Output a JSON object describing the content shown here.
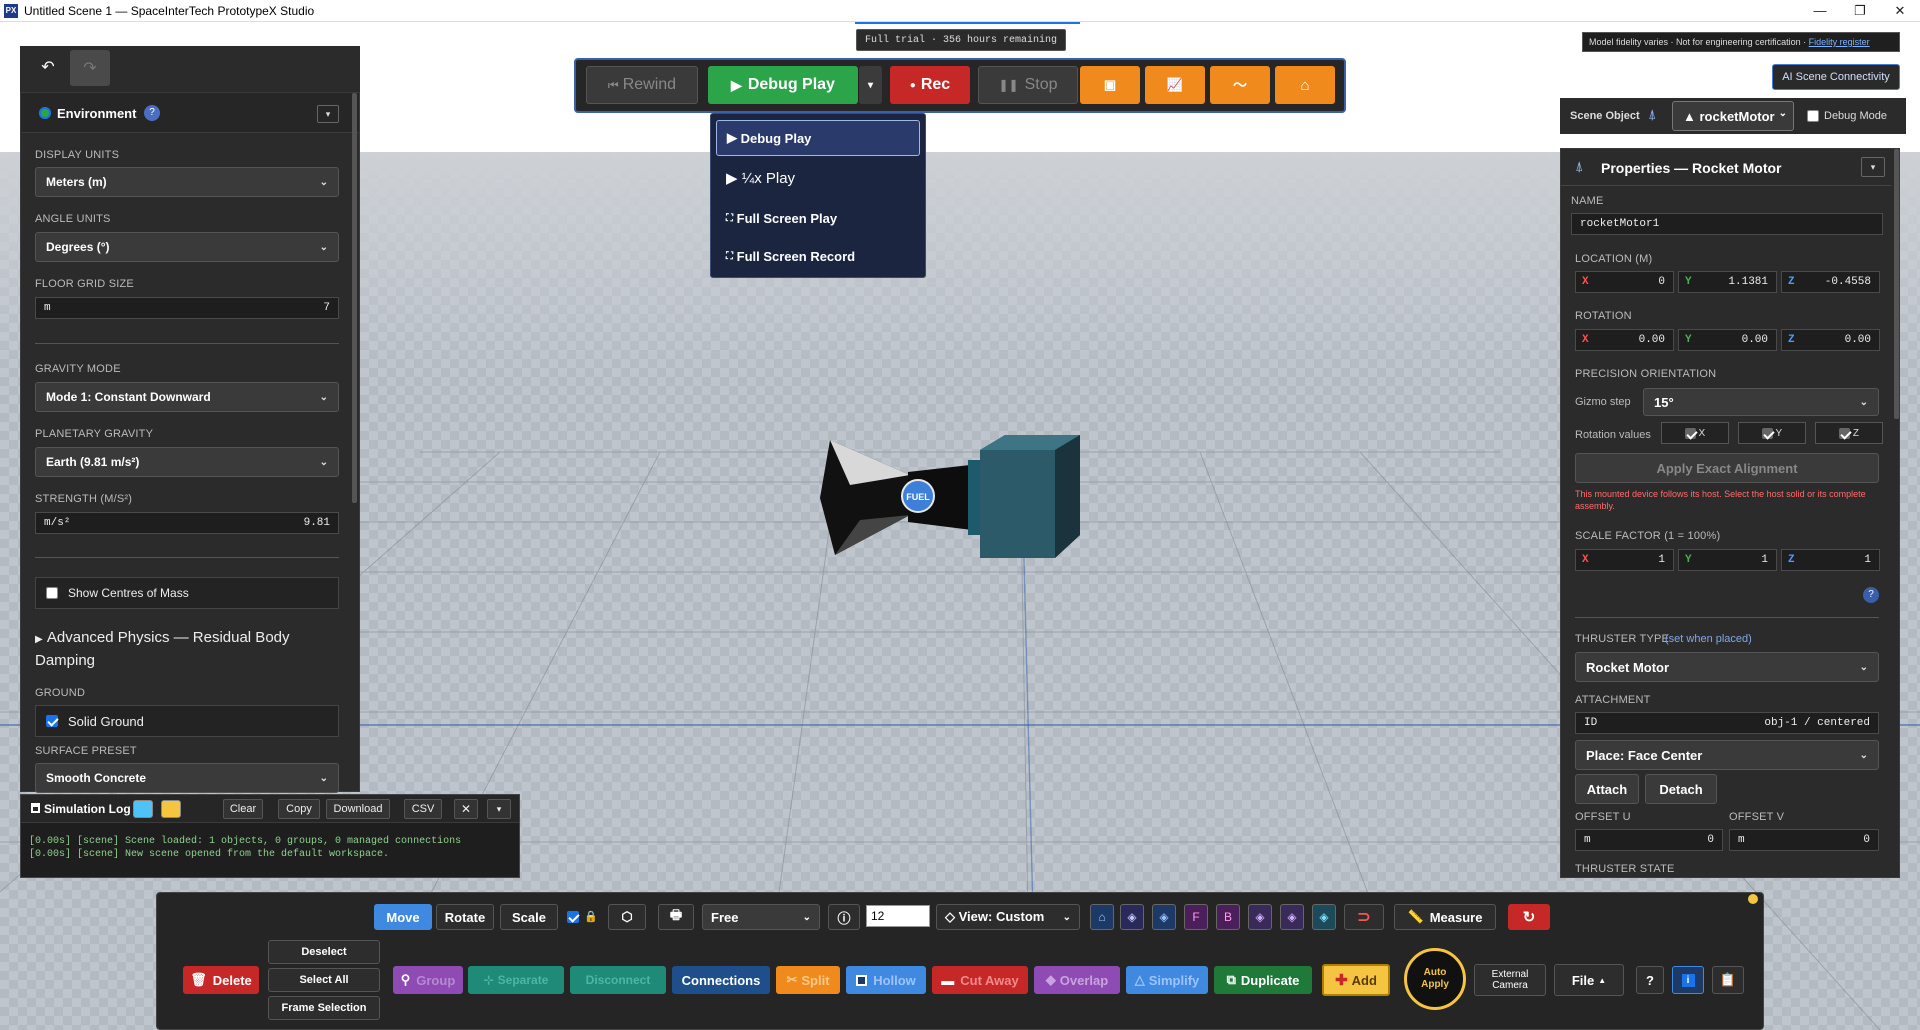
{
  "window": {
    "title": "Untitled Scene 1 — SpaceInterTech PrototypeX Studio",
    "app_icon": "PX"
  },
  "banner": {
    "trial": "Full trial · 356 hours remaining",
    "fidelity_note": "Model fidelity varies · Not for engineering certification ·",
    "fidelity_link": "Fidelity register",
    "ai_button": "AI Scene Connectivity"
  },
  "top_toolbar": {
    "rewind": "Rewind",
    "debug_play": "Debug Play",
    "rec": "Rec",
    "stop": "Stop"
  },
  "play_menu": {
    "items": [
      "Debug Play",
      "¼x Play",
      "Full Screen Play",
      "Full Screen Record"
    ]
  },
  "environment": {
    "title": "Environment",
    "display_units_label": "DISPLAY UNITS",
    "display_units": "Meters (m)",
    "angle_units_label": "ANGLE UNITS",
    "angle_units": "Degrees (°)",
    "floor_grid_label": "FLOOR GRID SIZE",
    "floor_grid_unit": "m",
    "floor_grid_value": "7",
    "gravity_mode_label": "GRAVITY MODE",
    "gravity_mode": "Mode 1: Constant Downward",
    "planetary_label": "PLANETARY GRAVITY",
    "planetary": "Earth (9.81 m/s²)",
    "strength_label": "STRENGTH (M/S²)",
    "strength_unit": "m/s²",
    "strength_value": "9.81",
    "show_com": "Show Centres of Mass",
    "advanced": "Advanced Physics — Residual Body Damping",
    "ground_label": "GROUND",
    "solid_ground": "Solid Ground",
    "surface_label": "SURFACE PRESET",
    "surface": "Smooth Concrete"
  },
  "sim_log": {
    "title": "Simulation Log",
    "buttons": [
      "Clear",
      "Copy",
      "Download",
      "CSV"
    ],
    "lines": [
      "[0.00s] [scene] Scene loaded: 1 objects, 0 groups, 0 managed connections",
      "[0.00s] [scene] New scene opened from the default workspace."
    ]
  },
  "scene_object": {
    "label": "Scene Object",
    "selected": "▲ rocketMotor",
    "debug_mode": "Debug Mode"
  },
  "properties": {
    "title": "Properties — Rocket Motor",
    "name_label": "NAME",
    "name": "rocketMotor1",
    "location_label": "LOCATION (M)",
    "loc_x": "0",
    "loc_y": "1.1381",
    "loc_z": "-0.4558",
    "rotation_label": "ROTATION",
    "rot_x": "0.00",
    "rot_y": "0.00",
    "rot_z": "0.00",
    "precision_label": "PRECISION ORIENTATION",
    "gizmo_label": "Gizmo step",
    "gizmo_value": "15°",
    "rotation_values_label": "Rotation values",
    "rv_x": "X",
    "rv_y": "Y",
    "rv_z": "Z",
    "apply_exact": "Apply Exact Alignment",
    "warning": "This mounted device follows its host. Select the host solid or its complete assembly.",
    "scale_label": "SCALE FACTOR (1 = 100%)",
    "sc_x": "1",
    "sc_y": "1",
    "sc_z": "1",
    "thruster_type_label": "THRUSTER TYPE",
    "thruster_type_hint": "(set when placed)",
    "thruster_type": "Rocket Motor",
    "attachment_label": "ATTACHMENT",
    "attach_id_label": "ID",
    "attach_id": "obj-1 / centered",
    "place": "Place: Face Center",
    "attach": "Attach",
    "detach": "Detach",
    "offset_u_label": "OFFSET U",
    "offset_u_unit": "m",
    "offset_u": "0",
    "offset_v_label": "OFFSET V",
    "offset_v_unit": "m",
    "offset_v": "0",
    "thruster_state_label": "THRUSTER STATE"
  },
  "bottom_toolbar": {
    "move": "Move",
    "rotate": "Rotate",
    "scale": "Scale",
    "mode": "Free",
    "step_value": "12",
    "view": "View: Custom",
    "measure": "Measure",
    "delete": "Delete",
    "deselect": "Deselect",
    "select_all": "Select All",
    "frame_selection": "Frame Selection",
    "group": "Group",
    "separate": "Separate",
    "disconnect": "Disconnect",
    "connections": "Connections",
    "split": "Split",
    "hollow": "Hollow",
    "cut_away": "Cut Away",
    "overlap": "Overlap",
    "simplify": "Simplify",
    "duplicate": "Duplicate",
    "add": "Add",
    "auto_apply": "Auto Apply",
    "external_camera": "External Camera",
    "file": "File",
    "help": "?"
  },
  "model": {
    "fuel_label": "FUEL"
  },
  "colors": {
    "accent": "#1a73e8",
    "orange": "#f08a1c",
    "green": "#2ca44a",
    "red": "#c62828",
    "panel": "#2b2b2b"
  }
}
